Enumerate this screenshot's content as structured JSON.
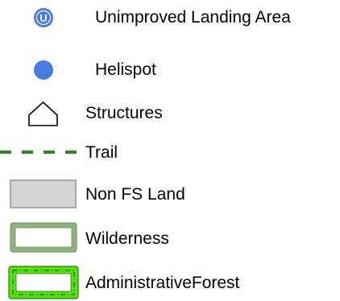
{
  "legend": {
    "items": [
      {
        "label": "Unimproved Landing Area",
        "icon": "unimproved-landing-area-icon",
        "symbol_text": "U",
        "color": "#4a7be0"
      },
      {
        "label": "Helispot",
        "icon": "helispot-icon",
        "color": "#4a7be0"
      },
      {
        "label": "Structures",
        "icon": "structures-icon",
        "color": "#000000"
      },
      {
        "label": "Trail",
        "icon": "trail-icon",
        "color": "#2e8b1f"
      },
      {
        "label": "Non FS Land",
        "icon": "non-fs-land-icon",
        "color": "#d4d4d4"
      },
      {
        "label": "Wilderness",
        "icon": "wilderness-icon",
        "color": "#8fb07f"
      },
      {
        "label": "AdministrativeForest",
        "icon": "administrative-forest-icon",
        "color": "#55e010"
      }
    ]
  }
}
